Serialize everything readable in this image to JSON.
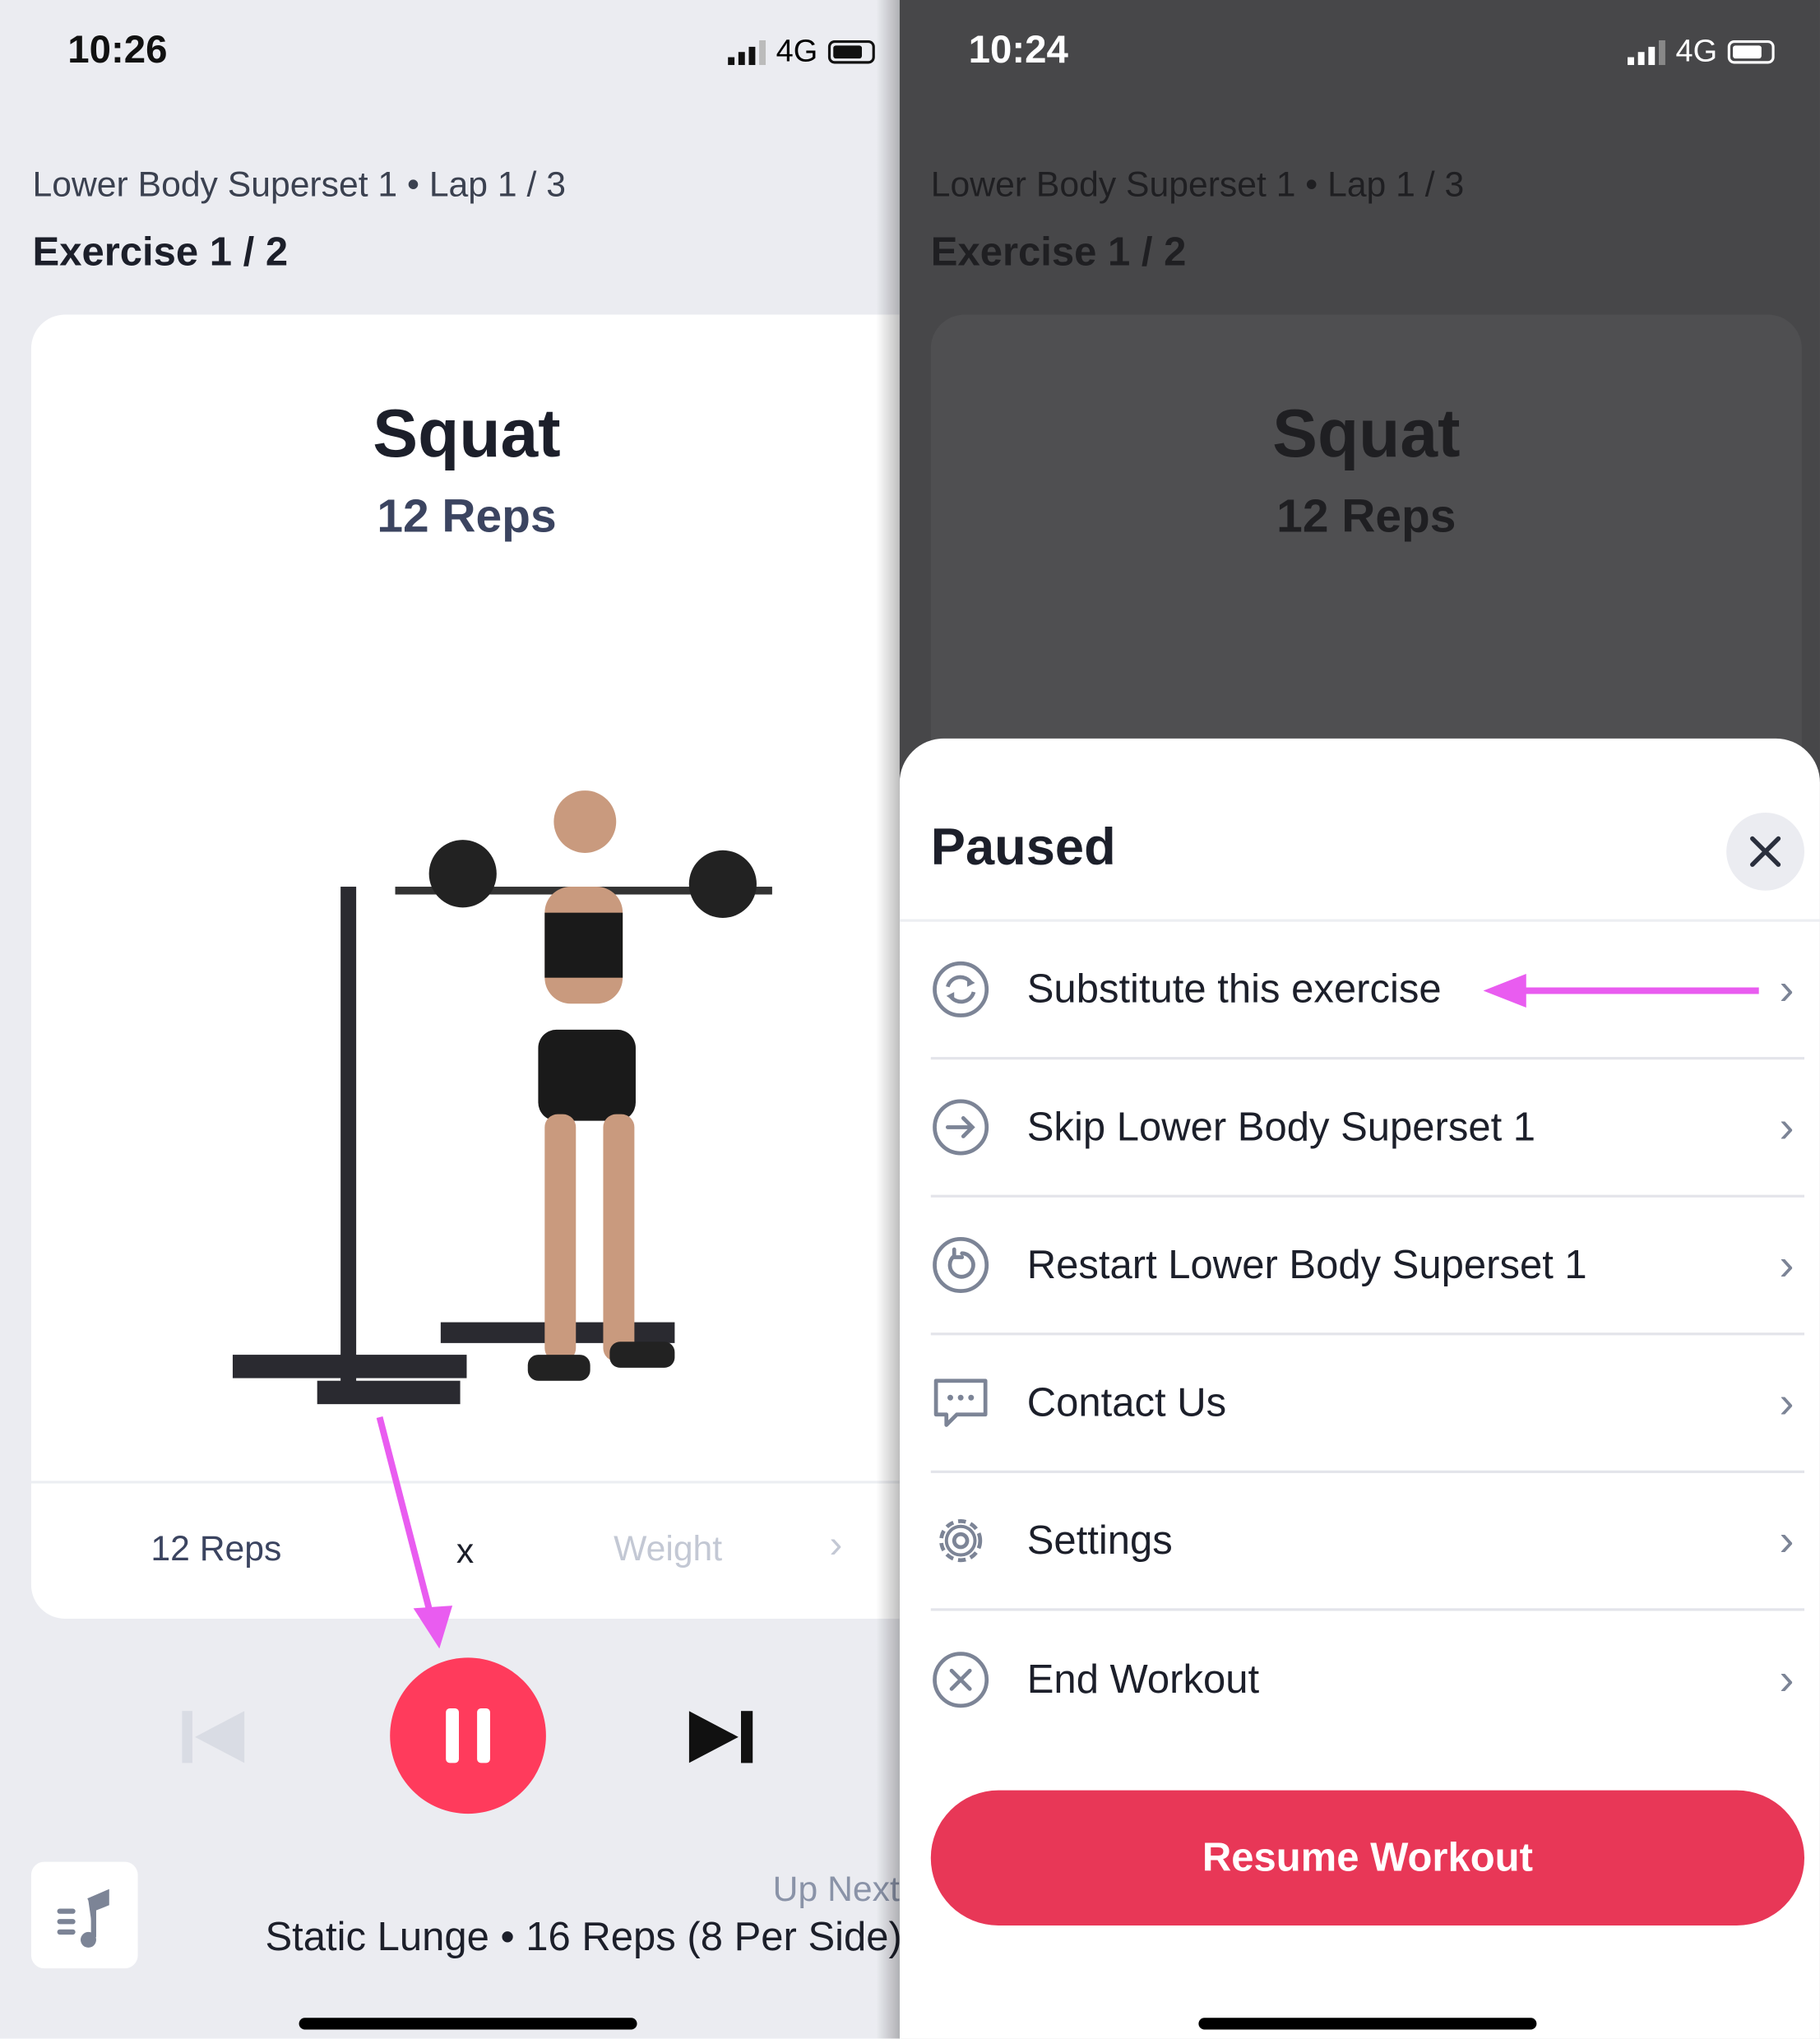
{
  "left_screen": {
    "status": {
      "time": "10:26",
      "network": "4G"
    },
    "breadcrumb": "Lower Body Superset 1 • Lap 1 / 3",
    "exercise_counter": "Exercise 1 / 2",
    "exercise": {
      "name": "Squat",
      "reps": "12 Reps"
    },
    "log": {
      "reps": "12 Reps",
      "times": "x",
      "weight_placeholder": "Weight"
    },
    "controls": {
      "previous": "previous-icon",
      "pause": "pause-icon",
      "next": "next-icon"
    },
    "up_next": {
      "label": "Up Next",
      "value": "Static Lunge • 16 Reps (8 Per Side)"
    },
    "music_icon": "music-playlist-icon"
  },
  "right_screen": {
    "status": {
      "time": "10:24",
      "network": "4G"
    },
    "breadcrumb": "Lower Body Superset 1 • Lap 1 / 3",
    "exercise_counter": "Exercise 1 / 2",
    "exercise": {
      "name": "Squat",
      "reps": "12 Reps"
    },
    "sheet": {
      "title": "Paused",
      "items": [
        {
          "label": "Substitute this exercise",
          "icon": "substitute-icon"
        },
        {
          "label": "Skip Lower Body Superset 1",
          "icon": "skip-icon"
        },
        {
          "label": "Restart Lower Body Superset 1",
          "icon": "restart-icon"
        },
        {
          "label": "Contact Us",
          "icon": "chat-icon"
        },
        {
          "label": "Settings",
          "icon": "gear-icon"
        },
        {
          "label": "End Workout",
          "icon": "close-circle-icon"
        }
      ],
      "resume_label": "Resume Workout"
    }
  },
  "colors": {
    "accent": "#ff3b5c",
    "annotation_arrow": "#e95cf0",
    "resume": "#e83757"
  }
}
